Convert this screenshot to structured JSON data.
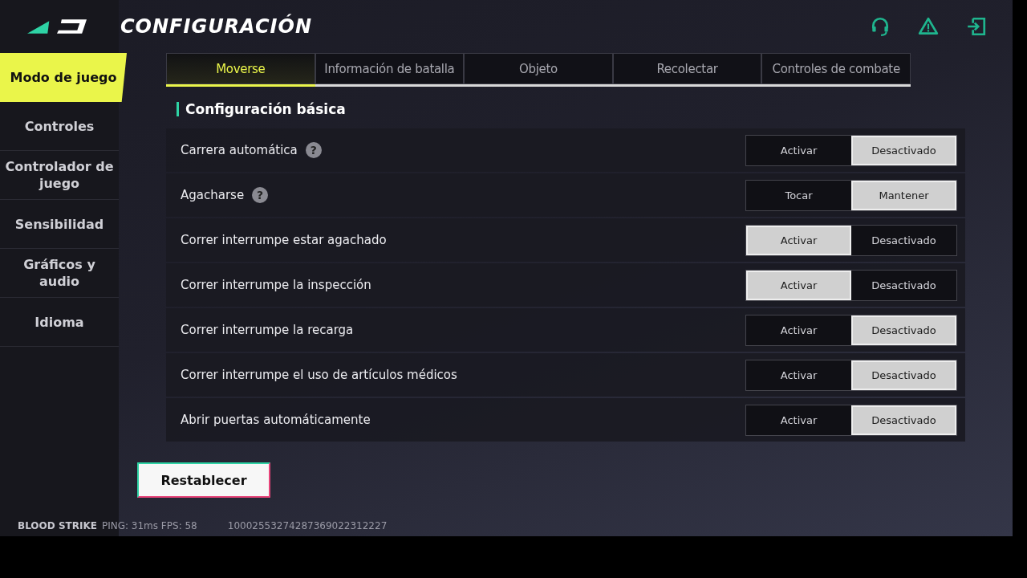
{
  "header": {
    "title": "CONFIGURACIÓN"
  },
  "sidebar": {
    "items": [
      {
        "label": "Modo de juego",
        "selected": true
      },
      {
        "label": "Controles",
        "selected": false
      },
      {
        "label": "Controlador de juego",
        "selected": false
      },
      {
        "label": "Sensibilidad",
        "selected": false
      },
      {
        "label": "Gráficos y audio",
        "selected": false
      },
      {
        "label": "Idioma",
        "selected": false
      }
    ]
  },
  "tabs": [
    {
      "label": "Moverse",
      "selected": true
    },
    {
      "label": "Información de batalla",
      "selected": false
    },
    {
      "label": "Objeto",
      "selected": false
    },
    {
      "label": "Recolectar",
      "selected": false
    },
    {
      "label": "Controles de combate",
      "selected": false
    }
  ],
  "section": {
    "title": "Configuración básica"
  },
  "settings": [
    {
      "label": "Carrera automática",
      "help": "?",
      "options": [
        {
          "label": "Activar",
          "selected": false
        },
        {
          "label": "Desactivado",
          "selected": true
        }
      ]
    },
    {
      "label": "Agacharse",
      "help": "?",
      "options": [
        {
          "label": "Tocar",
          "selected": false
        },
        {
          "label": "Mantener",
          "selected": true
        }
      ]
    },
    {
      "label": "Correr interrumpe estar agachado",
      "options": [
        {
          "label": "Activar",
          "selected": true
        },
        {
          "label": "Desactivado",
          "selected": false
        }
      ]
    },
    {
      "label": "Correr interrumpe la inspección",
      "options": [
        {
          "label": "Activar",
          "selected": true
        },
        {
          "label": "Desactivado",
          "selected": false
        }
      ]
    },
    {
      "label": "Correr interrumpe la recarga",
      "options": [
        {
          "label": "Activar",
          "selected": false
        },
        {
          "label": "Desactivado",
          "selected": true
        }
      ]
    },
    {
      "label": "Correr interrumpe el uso de artículos médicos",
      "options": [
        {
          "label": "Activar",
          "selected": false
        },
        {
          "label": "Desactivado",
          "selected": true
        }
      ]
    },
    {
      "label": "Abrir puertas automáticamente",
      "options": [
        {
          "label": "Activar",
          "selected": false
        },
        {
          "label": "Desactivado",
          "selected": true
        }
      ]
    }
  ],
  "reset_button": "Restablecer",
  "footer": {
    "game": "BLOOD STRIKE",
    "stats": "PING: 31ms FPS: 58",
    "id": "10002553274287369022312227"
  }
}
